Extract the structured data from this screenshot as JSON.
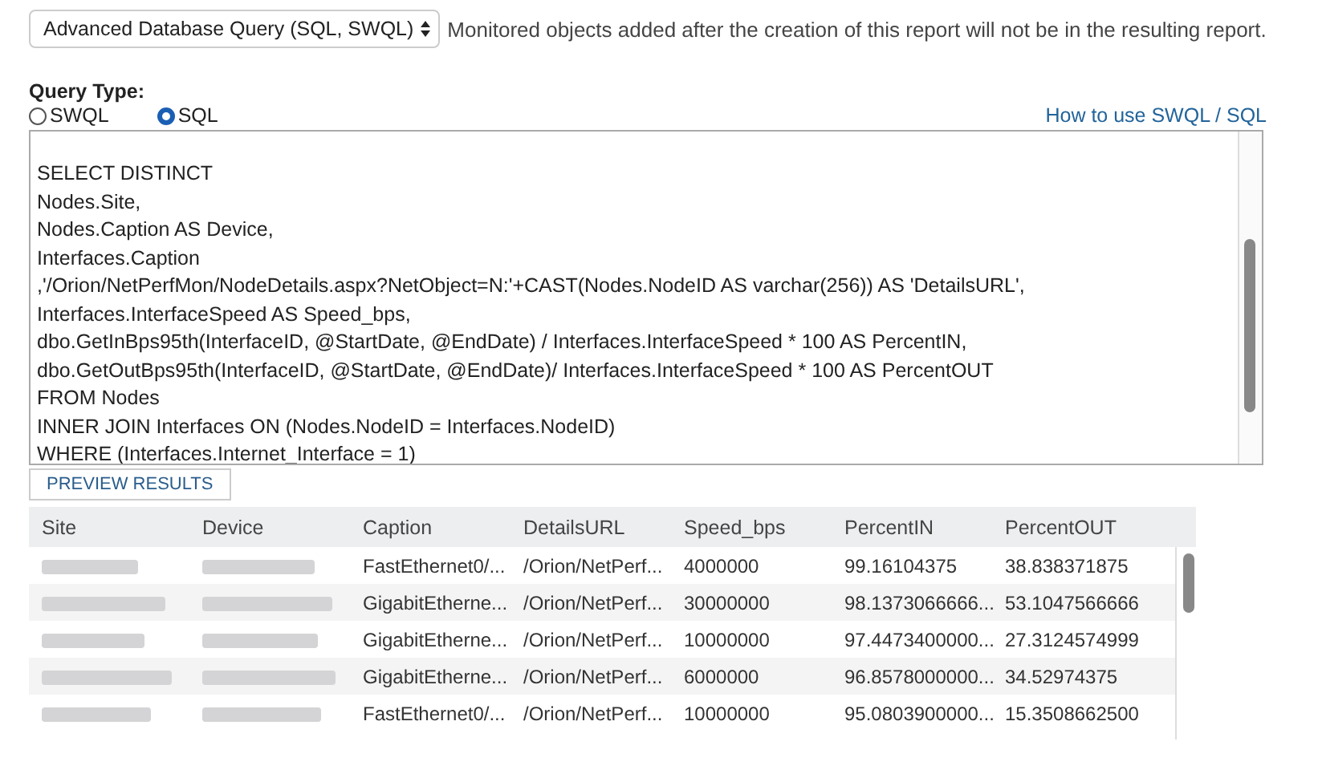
{
  "report_source": {
    "selected_option": "Advanced Database Query (SQL, SWQL)",
    "note": "Monitored objects added after the creation of this report will not be in the resulting report."
  },
  "query_type": {
    "label": "Query Type:",
    "options": [
      {
        "label": "SWQL",
        "selected": false
      },
      {
        "label": "SQL",
        "selected": true
      }
    ],
    "help_link": "How to use SWQL / SQL"
  },
  "query_lines": [
    "SELECT DISTINCT",
    "Nodes.Site,",
    "Nodes.Caption AS Device,",
    "Interfaces.Caption",
    ",'/Orion/NetPerfMon/NodeDetails.aspx?NetObject=N:'+CAST(Nodes.NodeID AS varchar(256)) AS 'DetailsURL',",
    "Interfaces.InterfaceSpeed AS Speed_bps,",
    "dbo.GetInBps95th(InterfaceID, @StartDate, @EndDate) / Interfaces.InterfaceSpeed * 100 AS PercentIN,",
    "dbo.GetOutBps95th(InterfaceID, @StartDate, @EndDate)/ Interfaces.InterfaceSpeed * 100 AS PercentOUT",
    "FROM Nodes",
    "INNER JOIN Interfaces ON (Nodes.NodeID = Interfaces.NodeID)",
    "WHERE (Interfaces.Internet_Interface = 1)"
  ],
  "preview_button": "PREVIEW RESULTS",
  "table": {
    "columns": [
      "Site",
      "Device",
      "Caption",
      "DetailsURL",
      "Speed_bps",
      "PercentIN",
      "PercentOUT"
    ],
    "rows": [
      {
        "caption": "FastEthernet0/...",
        "details_url": "/Orion/NetPerf...",
        "speed_bps": "4000000",
        "percent_in": "99.16104375",
        "percent_out": "38.838371875"
      },
      {
        "caption": "GigabitEtherne...",
        "details_url": "/Orion/NetPerf...",
        "speed_bps": "30000000",
        "percent_in": "98.1373066666...",
        "percent_out": "53.1047566666"
      },
      {
        "caption": "GigabitEtherne...",
        "details_url": "/Orion/NetPerf...",
        "speed_bps": "10000000",
        "percent_in": "97.4473400000...",
        "percent_out": "27.3124574999"
      },
      {
        "caption": "GigabitEtherne...",
        "details_url": "/Orion/NetPerf...",
        "speed_bps": "6000000",
        "percent_in": "96.8578000000...",
        "percent_out": "34.52974375"
      },
      {
        "caption": "FastEthernet0/...",
        "details_url": "/Orion/NetPerf...",
        "speed_bps": "10000000",
        "percent_in": "95.0803900000...",
        "percent_out": "15.3508662500"
      }
    ]
  }
}
